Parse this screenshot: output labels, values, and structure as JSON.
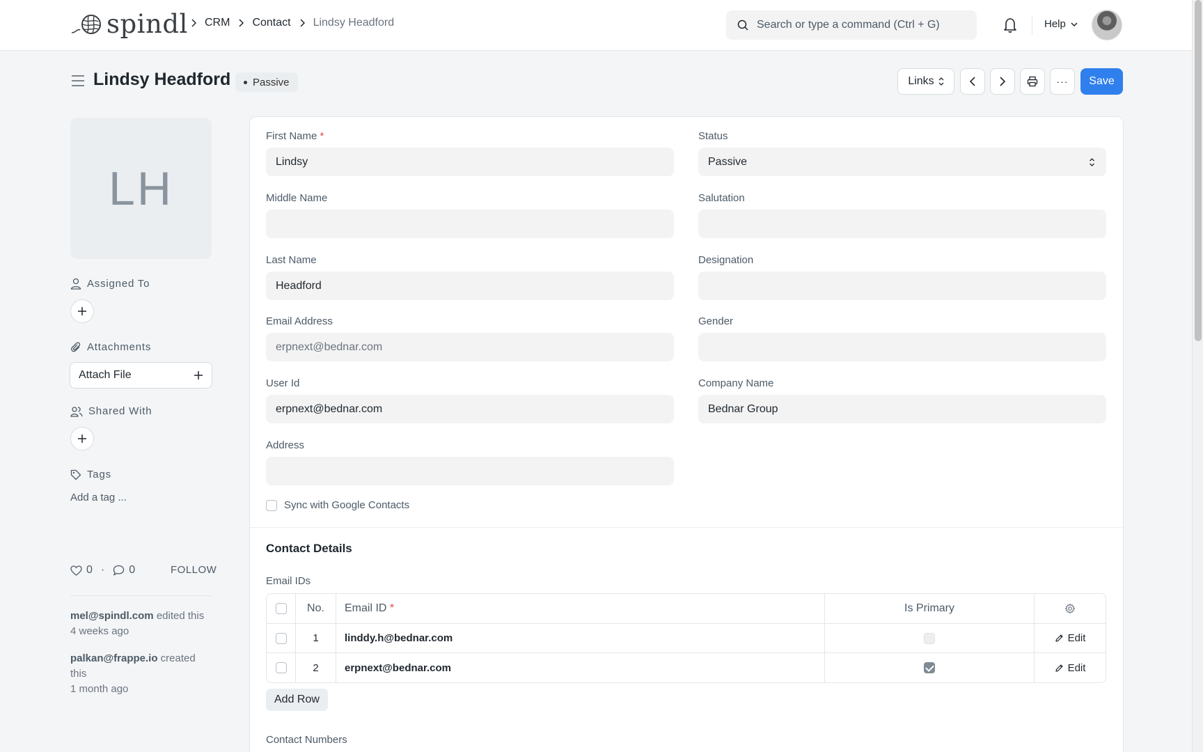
{
  "navbar": {
    "brand": "spindl",
    "breadcrumbs": [
      "CRM",
      "Contact",
      "Lindsy Headford"
    ],
    "search_placeholder": "Search or type a command (Ctrl + G)",
    "help_label": "Help"
  },
  "page": {
    "title": "Lindsy Headford",
    "status_badge": "Passive",
    "actions": {
      "links": "Links",
      "more": "···",
      "save": "Save"
    }
  },
  "sidebar": {
    "avatar_initials": "LH",
    "assigned_to": "Assigned To",
    "attachments": "Attachments",
    "attach_file": "Attach File",
    "shared_with": "Shared With",
    "tags": "Tags",
    "add_tag": "Add a tag ...",
    "likes": "0",
    "comments": "0",
    "follow": "FOLLOW",
    "activity": [
      {
        "user": "mel@spindl.com",
        "action": " edited this",
        "time": "4 weeks ago"
      },
      {
        "user": "palkan@frappe.io",
        "action": " created this",
        "time": "1 month ago"
      }
    ]
  },
  "form": {
    "first_name": {
      "label": "First Name",
      "value": "Lindsy"
    },
    "middle_name": {
      "label": "Middle Name",
      "value": ""
    },
    "last_name": {
      "label": "Last Name",
      "value": "Headford"
    },
    "email_address": {
      "label": "Email Address",
      "value": "erpnext@bednar.com"
    },
    "user_id": {
      "label": "User Id",
      "value": "erpnext@bednar.com"
    },
    "address": {
      "label": "Address",
      "value": ""
    },
    "status": {
      "label": "Status",
      "value": "Passive"
    },
    "salutation": {
      "label": "Salutation",
      "value": ""
    },
    "designation": {
      "label": "Designation",
      "value": ""
    },
    "gender": {
      "label": "Gender",
      "value": ""
    },
    "company_name": {
      "label": "Company Name",
      "value": "Bednar Group"
    },
    "sync_google": "Sync with Google Contacts",
    "contact_details_title": "Contact Details",
    "email_ids_label": "Email IDs",
    "email_table": {
      "headers": {
        "no": "No.",
        "email": "Email ID",
        "primary": "Is Primary"
      },
      "rows": [
        {
          "no": "1",
          "email": "linddy.h@bednar.com",
          "primary": false,
          "edit": "Edit"
        },
        {
          "no": "2",
          "email": "erpnext@bednar.com",
          "primary": true,
          "edit": "Edit"
        }
      ]
    },
    "add_row": "Add Row",
    "contact_numbers_label": "Contact Numbers"
  }
}
